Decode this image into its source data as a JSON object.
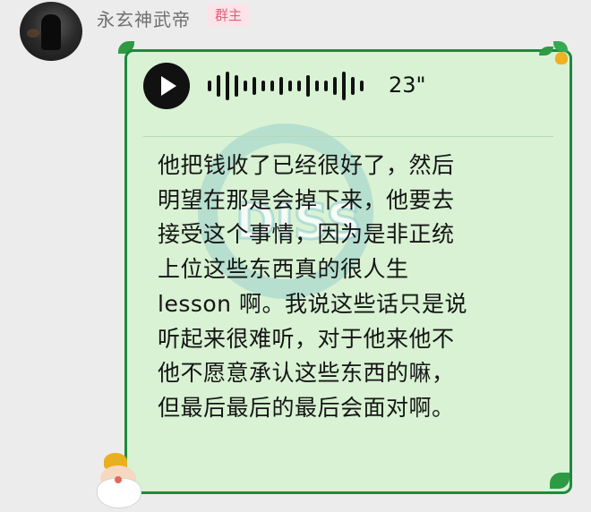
{
  "sender": {
    "name": "永玄神武帝",
    "role_badge": "群主"
  },
  "voice_message": {
    "duration": "23\"",
    "transcript": "他把钱收了已经很好了，然后\n明望在那是会掉下来，他要去\n接受这个事情，因为是非正统\n上位这些东西真的很人生\nlesson 啊。我说这些话只是说\n听起来很难听，对于他来他不\n他不愿意承认这些东西的嘛，\n但最后最后的最后会面对啊。"
  },
  "watermark": {
    "logo_text": "DISS"
  },
  "icons": {
    "play": "play-icon",
    "waveform": "waveform-icon",
    "santa": "santa-sticker-icon",
    "holly": "holly-decoration-icon"
  },
  "colors": {
    "bubble_bg": "#d8f2d3",
    "bubble_border": "#1e8a3c",
    "badge_text": "#e0607a",
    "badge_bg": "#fbe3e8"
  }
}
